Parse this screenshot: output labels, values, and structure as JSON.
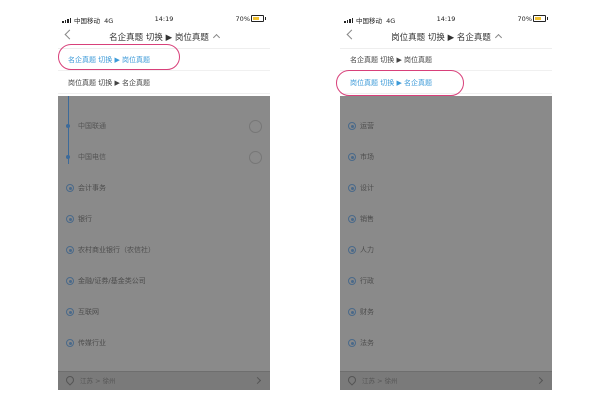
{
  "status_bar": {
    "carrier": "中国移动",
    "network": "4G",
    "time": "14:19",
    "battery": "70%"
  },
  "colors": {
    "accent": "#3c9ad8",
    "highlight": "#d8407a",
    "overlay": "#8a8a8a"
  },
  "left_screen": {
    "nav_title": "名企真题 切换 ▶ 岗位真题",
    "dropdown_active": "名企真题 切换 ▶ 岗位真题",
    "dropdown_inactive": "岗位真题 切换 ▶ 名企真题",
    "sub_items": [
      "中国联通",
      "中国电信"
    ],
    "categories": [
      "会计事务",
      "银行",
      "农村商业银行（农信社）",
      "金融/证券/基金类公司",
      "互联网",
      "传媒行业"
    ],
    "location": "江苏 > 徐州"
  },
  "right_screen": {
    "nav_title": "岗位真题 切换 ▶ 名企真题",
    "dropdown_inactive": "名企真题 切换 ▶ 岗位真题",
    "dropdown_active": "岗位真题 切换 ▶ 名企真题",
    "categories": [
      "运营",
      "市场",
      "设计",
      "销售",
      "人力",
      "行政",
      "财务",
      "法务"
    ],
    "location": "江苏 > 徐州"
  }
}
